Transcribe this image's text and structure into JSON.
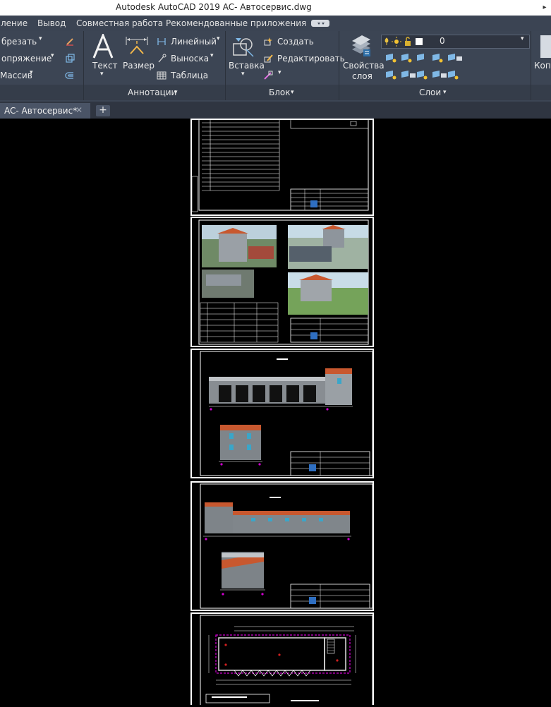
{
  "window": {
    "title": "Autodesk AutoCAD 2019    AC- Автосервис.dwg",
    "control_icon": "chevron-right-icon"
  },
  "menu": {
    "items": [
      "ление",
      "Вывод",
      "Совместная работа",
      "Рекомендованные приложения"
    ],
    "extra_icon": "ribbon-toggle-icon"
  },
  "ribbon": {
    "modify": {
      "trim": "брезать",
      "fillet": "опряжение",
      "array": "Массив"
    },
    "annotations": {
      "text_btn": "Текст",
      "dimension_btn": "Размер",
      "linear": "Линейный",
      "leader": "Выноска",
      "table": "Таблица",
      "panel_title": "Аннотации"
    },
    "block": {
      "insert_btn": "Вставка",
      "create": "Создать",
      "edit": "Редактировать",
      "panel_title": "Блок"
    },
    "layers": {
      "properties_btn_line1": "Свойства",
      "properties_btn_line2": "слоя",
      "current_layer": "0",
      "panel_title": "Слои"
    },
    "clipboard": {
      "copy_partial": "Копи"
    }
  },
  "tabs": {
    "active": "AC- Автосервис*",
    "close": "✕",
    "new": "+"
  },
  "colors": {
    "ribbon_bg": "#3c4554",
    "menubar_bg": "#3b4453",
    "tab_active": "#4a5466",
    "canvas": "#000000",
    "roof_orange": "#c8582f",
    "window_blue": "#3aa6c9",
    "magenta": "#d000d0"
  }
}
